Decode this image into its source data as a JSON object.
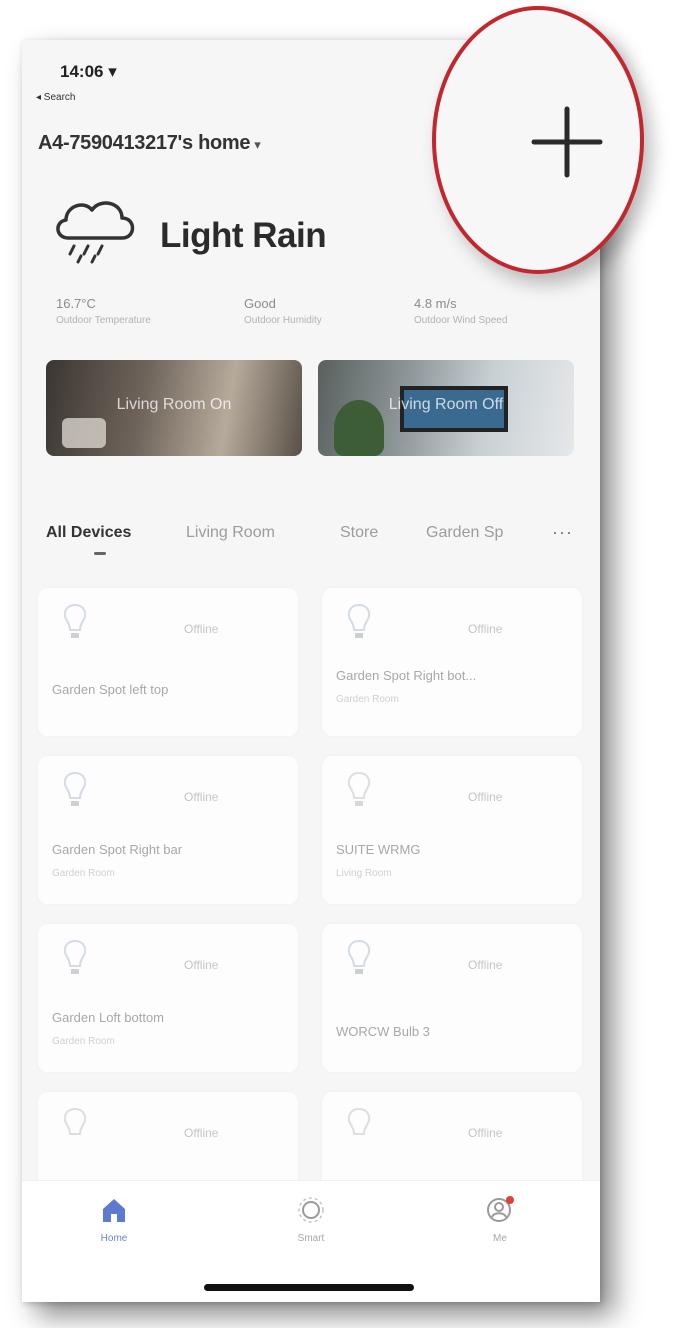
{
  "status_bar": {
    "time": "14:06 ▾",
    "back_label": "◂ Search"
  },
  "header": {
    "home_name": "A4-7590413217's home",
    "dropdown_glyph": "▾"
  },
  "weather": {
    "condition": "Light Rain",
    "icon": "cloud-rain-icon",
    "stats": [
      {
        "value": "16.7°C",
        "label": "Outdoor Temperature"
      },
      {
        "value": "Good",
        "label": "Outdoor Humidity"
      },
      {
        "value": "4.8 m/s",
        "label": "Outdoor Wind Speed"
      }
    ]
  },
  "scenes": [
    {
      "name": "Living Room On"
    },
    {
      "name": "Living Room Off"
    }
  ],
  "room_tabs": {
    "items": [
      "All Devices",
      "Living Room",
      "Store",
      "Garden Sp"
    ],
    "active": "All Devices",
    "more_glyph": "···"
  },
  "devices": [
    {
      "name": "Garden Spot left top",
      "status": "Offline",
      "room": ""
    },
    {
      "name": "Garden Spot Right bot...",
      "status": "Offline",
      "room": "Garden Room"
    },
    {
      "name": "Garden Spot Right bar",
      "status": "Offline",
      "room": "Garden Room"
    },
    {
      "name": "SUITE WRMG",
      "status": "Offline",
      "room": "Living Room"
    },
    {
      "name": "Garden Loft bottom",
      "status": "Offline",
      "room": "Garden Room"
    },
    {
      "name": "WORCW Bulb 3",
      "status": "Offline",
      "room": ""
    },
    {
      "name": "",
      "status": "Offline",
      "room": ""
    },
    {
      "name": "",
      "status": "Offline",
      "room": ""
    }
  ],
  "bottom_nav": [
    {
      "label": "Home",
      "icon": "home-icon",
      "active": true
    },
    {
      "label": "Smart",
      "icon": "smart-icon",
      "active": false
    },
    {
      "label": "Me",
      "icon": "me-icon",
      "active": false
    }
  ],
  "add_button": {
    "icon": "plus-icon"
  },
  "colors": {
    "highlight": "#c1272d",
    "nav_active": "#5b7ad0",
    "background": "#f6f6f7"
  }
}
